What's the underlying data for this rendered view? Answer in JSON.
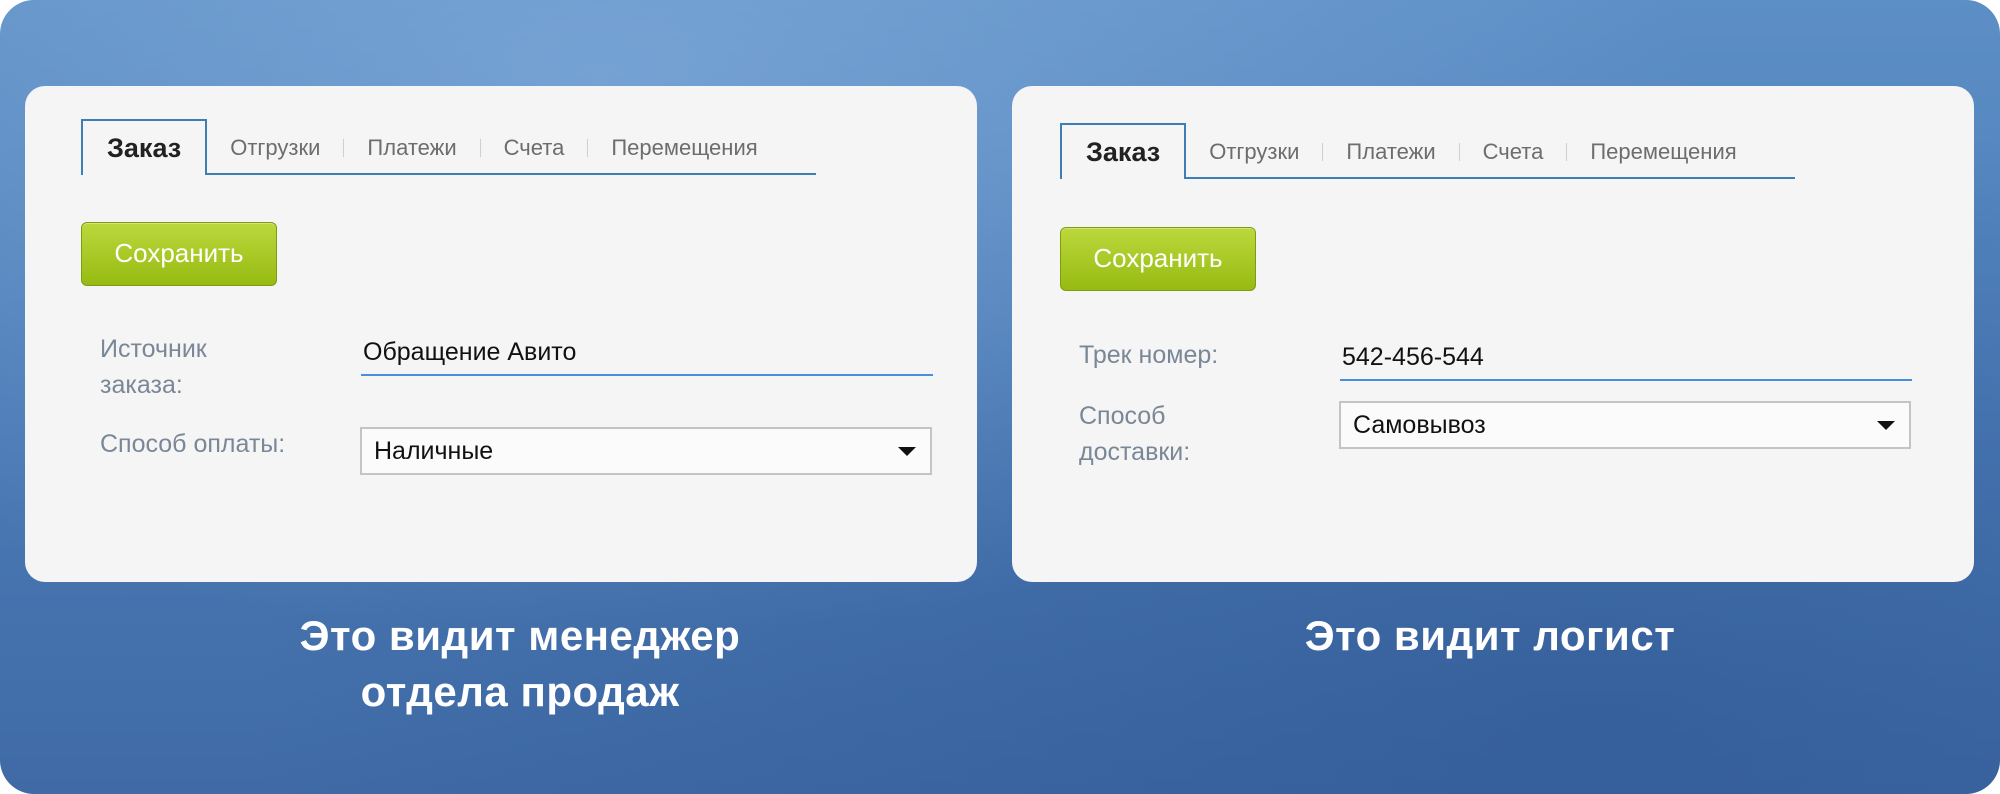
{
  "manager_panel": {
    "tabs": [
      "Заказ",
      "Отгрузки",
      "Платежи",
      "Счета",
      "Перемещения"
    ],
    "save_label": "Сохранить",
    "source_label": "Источник заказа:",
    "source_value": "Обращение Авито",
    "payment_label": "Способ оплаты:",
    "payment_value": "Наличные"
  },
  "logist_panel": {
    "tabs": [
      "Заказ",
      "Отгрузки",
      "Платежи",
      "Счета",
      "Перемещения"
    ],
    "save_label": "Сохранить",
    "track_label": "Трек номер:",
    "track_value": "542-456-544",
    "delivery_label": "Способ доставки:",
    "delivery_value": "Самовывоз"
  },
  "captions": {
    "manager": "Это видит менеджер отдела продаж",
    "logist": "Это видит логист"
  },
  "colors": {
    "background": "#4d7db8",
    "tab_border": "#3d7fb4",
    "save_button": "#a6c71f",
    "input_underline": "#4a90d9",
    "label_text": "#7a8797"
  },
  "icons": [
    "dropdown-arrow-icon"
  ]
}
